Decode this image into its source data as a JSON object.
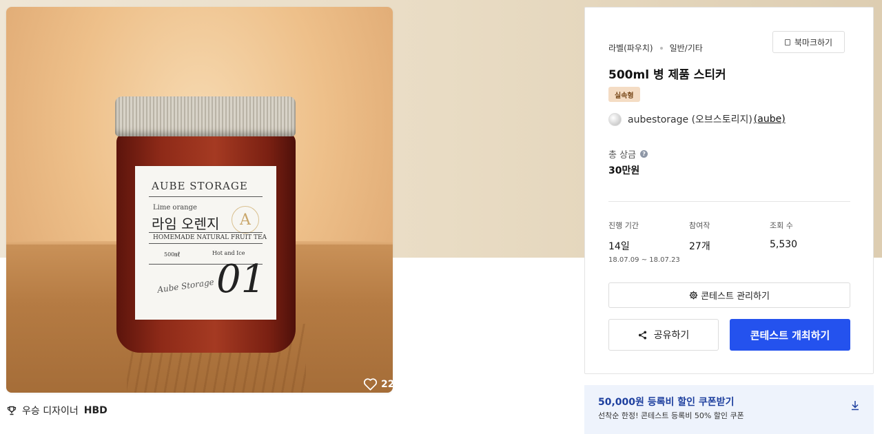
{
  "product_image": {
    "label_brand": "AUBE STORAGE",
    "label_flavor_en": "Lime orange",
    "label_flavor_ko": "라임 오렌지",
    "label_tagline": "HOMEMADE NATURAL FRUIT TEA",
    "label_size": "500㎖",
    "label_serve": "Hot and Ice",
    "label_signature": "Aube Storage",
    "label_number": "01",
    "label_emblem": "A",
    "like_count": "22"
  },
  "winner": {
    "prefix": "우승 디자이너",
    "name": "HBD"
  },
  "info": {
    "category": "라벨(파우치)",
    "subcategory": "일반/기타",
    "bookmark_label": "북마크하기",
    "title": "500ml 병 제품 스티커",
    "type_badge": "실속형",
    "host_name": "aubestorage (오브스토리지)",
    "host_handle": "(aube)",
    "prize_label": "총 상금",
    "prize_help": "?",
    "prize_value": "30만원",
    "stats": [
      {
        "label": "진행 기간",
        "value": "14일",
        "sub": "18.07.09 ~ 18.07.23"
      },
      {
        "label": "참여작",
        "value": "27개"
      },
      {
        "label": "조회 수",
        "value": "5,530"
      }
    ],
    "manage_label": "콘테스트 관리하기",
    "share_label": "공유하기",
    "host_contest_label": "콘테스트 개최하기"
  },
  "coupon": {
    "title": "50,000원 등록비 할인 쿠폰받기",
    "description": "선착순 한정! 콘테스트 등록비 50% 할인 쿠폰"
  },
  "colors": {
    "primary": "#2452ee",
    "badge_bg": "#f4dcc4",
    "coupon_bg": "#eef3fc",
    "coupon_title": "#1d3f9e"
  }
}
